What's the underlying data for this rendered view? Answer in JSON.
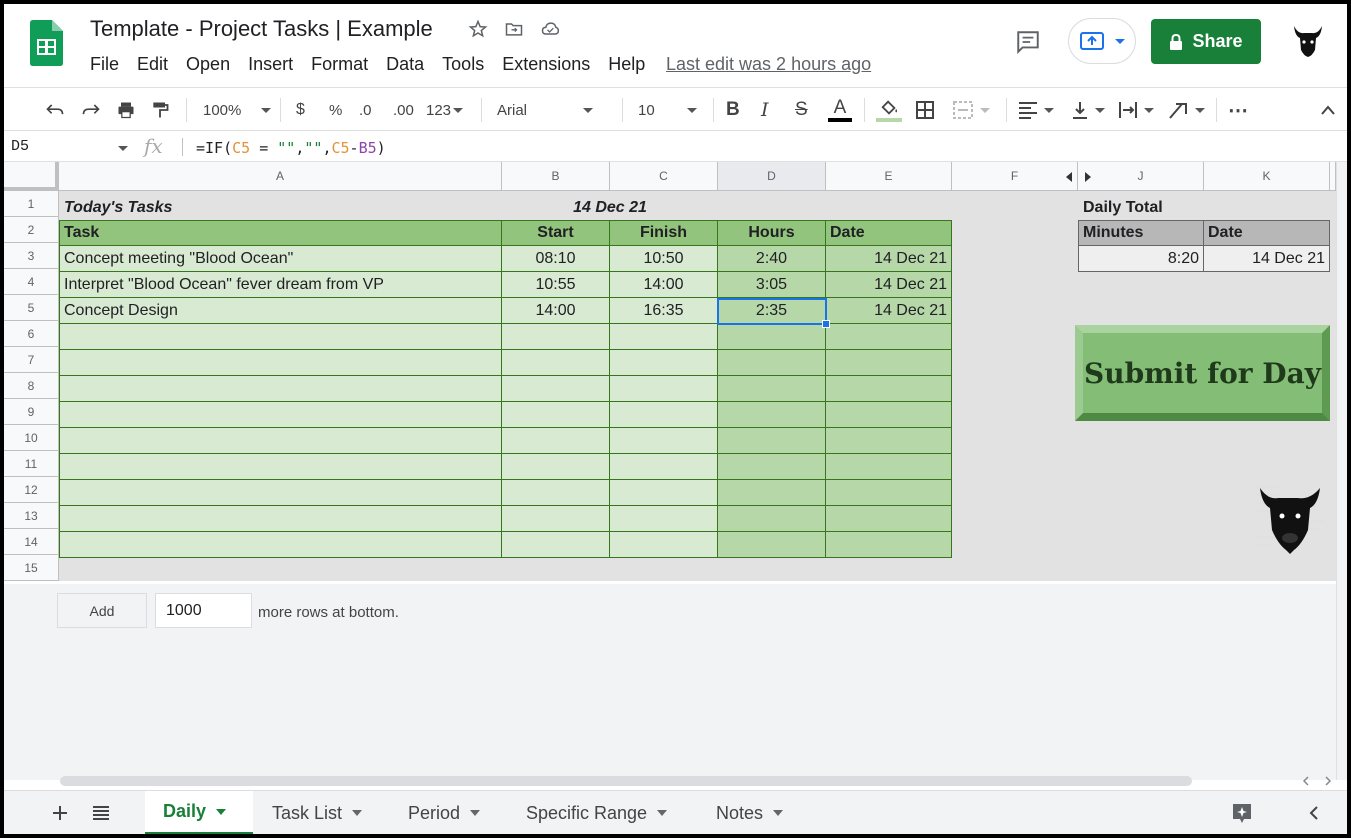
{
  "header": {
    "doc_title": "Template - Project Tasks | Example",
    "menu": [
      "File",
      "Edit",
      "Open",
      "Insert",
      "Format",
      "Data",
      "Tools",
      "Extensions",
      "Help"
    ],
    "last_edit": "Last edit was 2 hours ago",
    "share_label": "Share"
  },
  "toolbar": {
    "zoom": "100%",
    "currency": "$",
    "percent": "%",
    "dec_decrease": ".0",
    "dec_increase": ".00",
    "more_formats": "123",
    "font": "Arial",
    "font_size": "10",
    "bold": "B",
    "italic": "I",
    "strike": "S",
    "text_color": "A",
    "more": "⋯"
  },
  "formula_bar": {
    "name_box": "D5",
    "fx": "fx",
    "formula_parts": [
      "=IF(",
      "C5",
      " = ",
      "\"\"",
      ",",
      "\"\"",
      ",",
      "C5",
      "-",
      "B5",
      ")"
    ]
  },
  "columns": [
    "A",
    "B",
    "C",
    "D",
    "E",
    "F",
    "J",
    "K"
  ],
  "rows": [
    "1",
    "2",
    "3",
    "4",
    "5",
    "6",
    "7",
    "8",
    "9",
    "10",
    "11",
    "12",
    "13",
    "14",
    "15"
  ],
  "sheet": {
    "title_left": "Today's Tasks",
    "title_date": "14 Dec 21",
    "headers": [
      "Task",
      "Start",
      "Finish",
      "Hours",
      "Date"
    ],
    "tasks": [
      {
        "task": "Concept meeting \"Blood Ocean\"",
        "start": "08:10",
        "finish": "10:50",
        "hours": "2:40",
        "date": "14 Dec 21"
      },
      {
        "task": "Interpret \"Blood Ocean\" fever dream from VP",
        "start": "10:55",
        "finish": "14:00",
        "hours": "3:05",
        "date": "14 Dec 21"
      },
      {
        "task": "Concept Design",
        "start": "14:00",
        "finish": "16:35",
        "hours": "2:35",
        "date": "14 Dec 21"
      }
    ],
    "daily_total_label": "Daily Total",
    "total_headers": [
      "Minutes",
      "Date"
    ],
    "total_values": [
      "8:20",
      "14 Dec 21"
    ],
    "submit_label": "Submit for Day"
  },
  "add_rows": {
    "button": "Add",
    "count": "1000",
    "suffix": "more rows at bottom."
  },
  "tabs": [
    {
      "label": "Daily",
      "active": true
    },
    {
      "label": "Task List",
      "active": false
    },
    {
      "label": "Period",
      "active": false
    },
    {
      "label": "Specific Range",
      "active": false
    },
    {
      "label": "Notes",
      "active": false
    }
  ],
  "colors": {
    "brand_green": "#188038",
    "header_green": "#93c47d",
    "task_green": "#d9ead3",
    "hours_green": "#b6d7a8",
    "selection_blue": "#1a73e8"
  }
}
